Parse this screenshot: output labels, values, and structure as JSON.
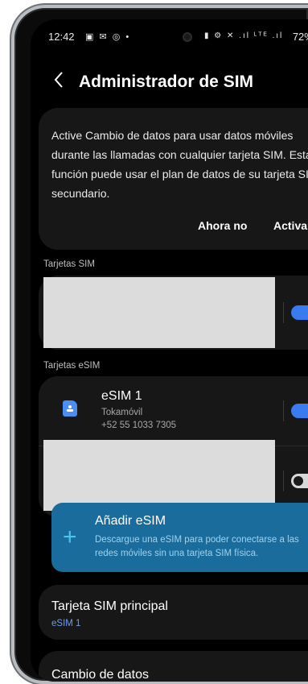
{
  "status_bar": {
    "time": "12:42",
    "left_icons": "▣ ✉ ◎ •",
    "right_icons": "▮ ⚙ ✕ .ıl ᴸᵀᴱ .ıl",
    "battery": "72%▮"
  },
  "header": {
    "back_icon": "chevron-left-icon",
    "title": "Administrador de SIM"
  },
  "info_card": {
    "text": "Active Cambio de datos para usar datos móviles durante las llamadas con cualquier tarjeta SIM. Esta función puede usar el plan de datos de su tarjeta SIM secundario.",
    "dismiss_label": "Ahora no",
    "activate_label": "Activar"
  },
  "sim_section": {
    "label": "Tarjetas SIM",
    "toggle_on": true
  },
  "esim_section": {
    "label": "Tarjetas eSIM",
    "items": [
      {
        "name": "eSIM 1",
        "carrier": "Tokamóvil",
        "number": "+52 55 1033 7305",
        "enabled": true
      }
    ],
    "second_toggle_on": false
  },
  "add_esim": {
    "title": "Añadir eSIM",
    "description": "Descargue una eSIM para poder conectarse a las redes móviles sin una tarjeta SIM física.",
    "icon": "plus-icon"
  },
  "principal": {
    "title": "Tarjeta SIM principal",
    "value": "eSIM 1"
  },
  "data_switch": {
    "title": "Cambio de datos"
  },
  "colors": {
    "accent_blue": "#3a7bf0",
    "add_esim_bg": "#1a6c9c",
    "card_bg": "#171717",
    "background": "#000000"
  }
}
